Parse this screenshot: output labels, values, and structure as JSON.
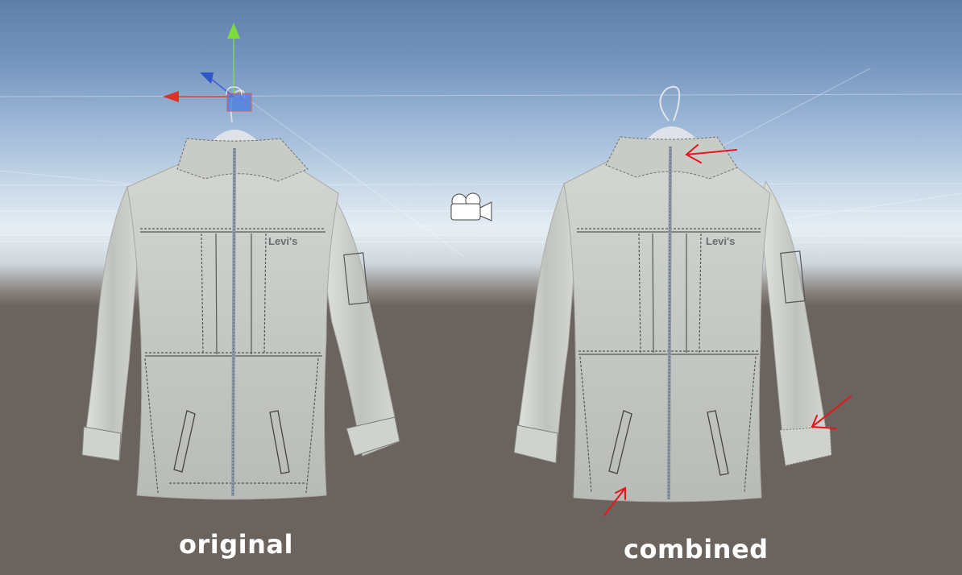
{
  "scene": {
    "sky_top_color": "#5f7ea9",
    "horizon_color": "#e6eef5",
    "ground_color": "#6b635e",
    "jacket_color": "#c9cbc6",
    "annotation_color": "#e8141a"
  },
  "labels": {
    "left_caption": "original",
    "right_caption": "combined",
    "left_brand": "Levi's",
    "right_brand": "Levi's"
  },
  "gizmo": {
    "icon": "move-gizmo-icon",
    "axes": [
      "y-axis",
      "z-axis",
      "x-axis"
    ]
  },
  "camera": {
    "icon": "scene-camera-icon"
  }
}
